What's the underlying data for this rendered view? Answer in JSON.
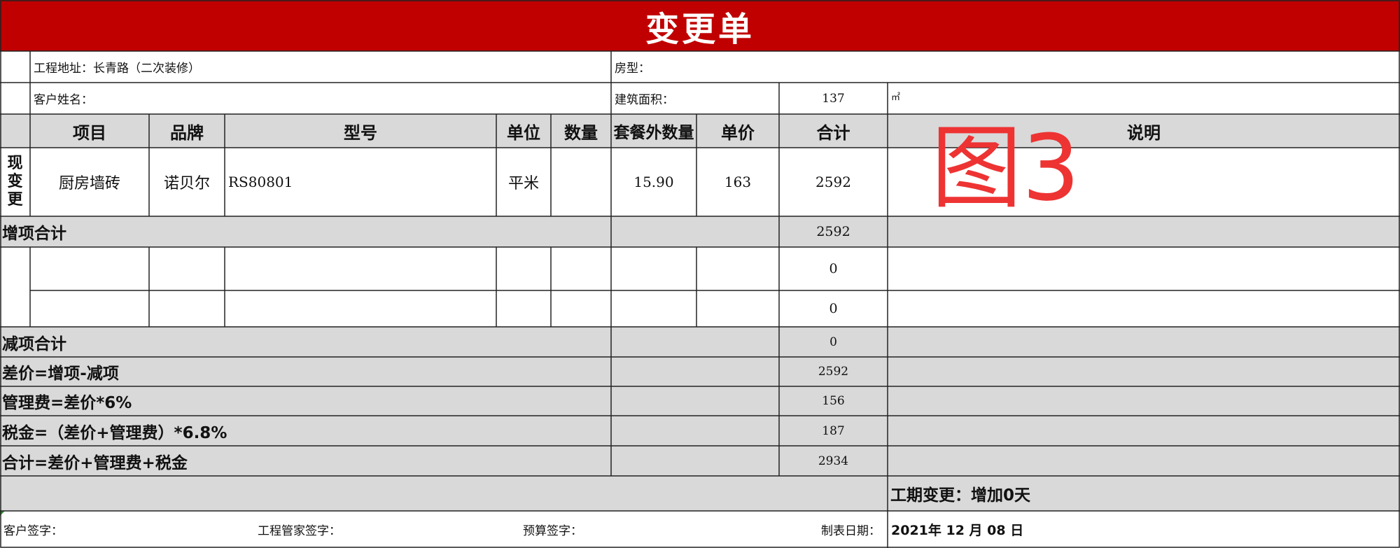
{
  "title": "变更单",
  "info": {
    "address_label": "工程地址：长青路（二次装修）",
    "house_type_label": "房型：",
    "customer_label": "客户姓名：",
    "area_label": "建筑面积：",
    "area_value": "137",
    "area_unit": "㎡"
  },
  "headers": [
    "项目",
    "品牌",
    "型号",
    "单位",
    "数量",
    "套餐外数量",
    "单价",
    "合计",
    "说明"
  ],
  "add_section": {
    "side_label": [
      "现",
      "变",
      "更"
    ],
    "rows": [
      {
        "item": "厨房墙砖",
        "brand": "诺贝尔",
        "model": "RS80801",
        "unit": "平米",
        "qty": "",
        "extra_qty": "15.90",
        "price": "163",
        "total": "2592",
        "note": ""
      }
    ],
    "subtotal_label": "增项合计",
    "subtotal_value": "2592"
  },
  "minus_section": {
    "rows": [
      {
        "total": "0"
      },
      {
        "total": "0"
      }
    ],
    "subtotal_label": "减项合计",
    "subtotal_value": "0"
  },
  "summary": [
    {
      "label": "差价=增项-减项",
      "value": "2592"
    },
    {
      "label": "管理费=差价*6%",
      "value": "156"
    },
    {
      "label": "税金=（差价+管理费）*6.8%",
      "value": "187"
    },
    {
      "label": "合计=差价+管理费+税金",
      "value": "2934"
    }
  ],
  "schedule_change": "工期变更：增加0天",
  "footer": {
    "customer_sign": "客户签字：",
    "manager_sign": "工程管家签字：",
    "budget_sign": "预算签字：",
    "date_label": "制表日期：",
    "date_value": "2021年 12 月 08 日"
  },
  "stamp": "图3",
  "colors": {
    "title_bg": "#c00000",
    "section_bg": "#d9d9d9",
    "stamp": "#ee3333"
  }
}
